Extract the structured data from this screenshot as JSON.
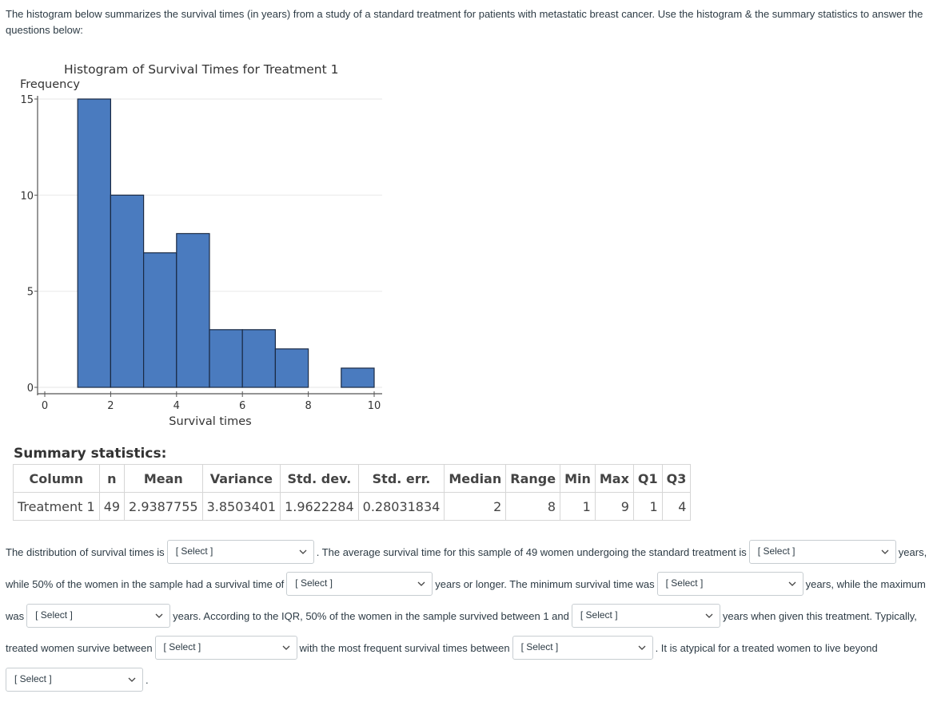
{
  "intro_text": "The histogram below summarizes the survival times (in years) from a study of a standard treatment for patients with metastatic breast cancer.  Use the histogram & the summary statistics to answer the questions below:",
  "chart_data": {
    "type": "bar",
    "title": "Histogram of Survival Times for Treatment 1",
    "xlabel": "Survival times",
    "ylabel": "Frequency",
    "bin_edges": [
      1,
      2,
      3,
      4,
      5,
      6,
      7,
      8,
      9,
      10
    ],
    "values": [
      15,
      10,
      7,
      8,
      3,
      3,
      2,
      0,
      1
    ],
    "xlim": [
      0,
      10
    ],
    "ylim": [
      0,
      15
    ],
    "x_ticks": [
      "0",
      "2",
      "4",
      "6",
      "8",
      "10"
    ],
    "y_ticks": [
      "0",
      "5",
      "10",
      "15"
    ],
    "grid": true,
    "bar_color": "#4a7bbf",
    "bar_edge_color": "#1a2a44"
  },
  "summary": {
    "title": "Summary statistics:",
    "headers": [
      "Column",
      "n",
      "Mean",
      "Variance",
      "Std. dev.",
      "Std. err.",
      "Median",
      "Range",
      "Min",
      "Max",
      "Q1",
      "Q3"
    ],
    "rows": [
      [
        "Treatment 1",
        "49",
        "2.9387755",
        "3.8503401",
        "1.9622284",
        "0.28031834",
        "2",
        "8",
        "1",
        "9",
        "1",
        "4"
      ]
    ]
  },
  "question": {
    "select_placeholder": "[ Select ]",
    "t1": "The distribution of survival times is",
    "t2": ".  The average survival time for this sample of 49 women undergoing the standard treatment is",
    "t3": "years,",
    "t4": "while 50% of the women in the sample had a survival time of",
    "t5": "years or longer. The minimum survival time was",
    "t6": "years, while the maximum",
    "t7": "was",
    "t8": "years. According to the IQR, 50% of the women in the sample survived between 1 and",
    "t9": "years when given this treatment.  Typically,",
    "t10": "treated women survive between",
    "t11": "with the most frequent survival times between",
    "t12": ".  It is atypical for a treated women to live beyond",
    "t13": "."
  }
}
